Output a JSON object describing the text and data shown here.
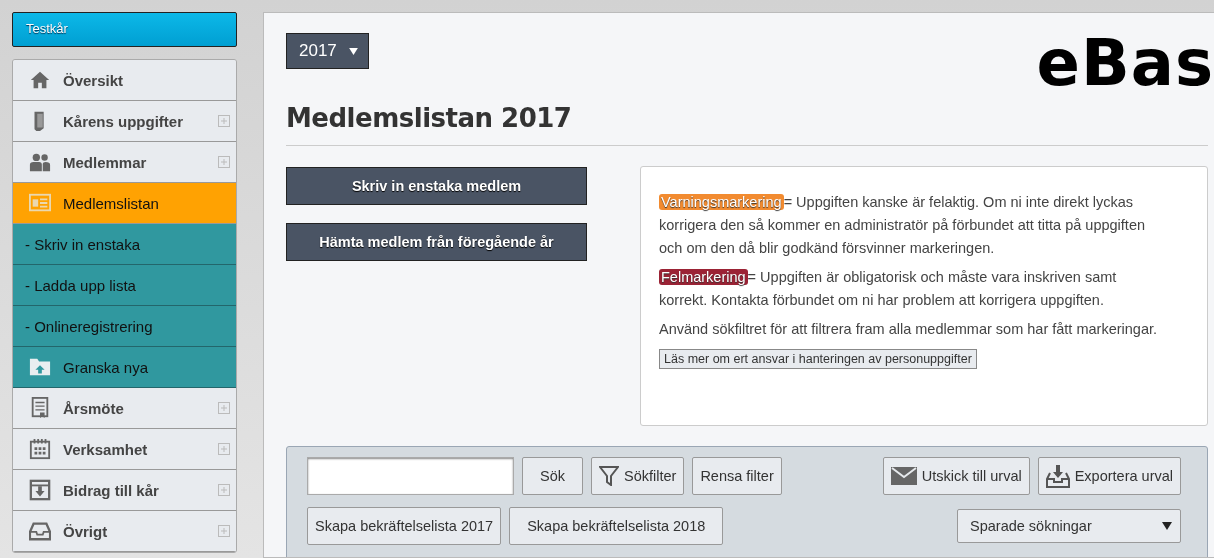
{
  "organization": {
    "name": "Testkår"
  },
  "sidebar": {
    "items": [
      {
        "label": "Översikt",
        "kind": "main",
        "selected": false,
        "expandable": false
      },
      {
        "label": "Kårens uppgifter",
        "kind": "main",
        "selected": false,
        "expandable": true
      },
      {
        "label": "Medlemmar",
        "kind": "main",
        "selected": false,
        "expandable": true
      },
      {
        "label": "Medlemslistan",
        "kind": "main",
        "selected": true,
        "expandable": false
      },
      {
        "label": "- Skriv in enstaka",
        "kind": "sub",
        "selected": false,
        "expandable": false
      },
      {
        "label": "- Ladda upp lista",
        "kind": "sub",
        "selected": false,
        "expandable": false
      },
      {
        "label": "- Onlineregistrering",
        "kind": "sub",
        "selected": false,
        "expandable": false
      },
      {
        "label": "Granska nya",
        "kind": "sub",
        "selected": false,
        "expandable": false
      },
      {
        "label": "Årsmöte",
        "kind": "main",
        "selected": false,
        "expandable": true
      },
      {
        "label": "Verksamhet",
        "kind": "main",
        "selected": false,
        "expandable": true
      },
      {
        "label": "Bidrag till kår",
        "kind": "main",
        "selected": false,
        "expandable": true
      },
      {
        "label": "Övrigt",
        "kind": "main",
        "selected": false,
        "expandable": true
      }
    ]
  },
  "year_select": {
    "value": "2017"
  },
  "logo": "eBas",
  "page_title": "Medlemslistan 2017",
  "actions": [
    "Skriv in enstaka medlem",
    "Hämta medlem från föregående år"
  ],
  "info": {
    "paragraphs": [
      {
        "tag": {
          "text": "Varningsmarkering",
          "color": "#f28b30"
        },
        "text": "= Uppgiften kanske är felaktig. Om ni inte direkt lyckas korrigera den så kommer en administratör på förbundet att titta på uppgiften och om den då blir godkänd försvinner markeringen."
      },
      {
        "tag": {
          "text": "Felmarkering",
          "color": "#9b2335"
        },
        "text": "= Uppgiften är obligatorisk och måste vara inskriven samt korrekt. Kontakta förbundet om ni har problem att korrigera uppgiften."
      },
      {
        "text": "Använd sökfiltret för att filtrera fram alla medlemmar som har fått markeringar."
      }
    ],
    "link_button": "Läs mer om ert ansvar i hanteringen av personuppgifter"
  },
  "toolbar": {
    "search_button": "Sök",
    "filter_button": "Sökfilter",
    "clear_button": "Rensa filter",
    "mail_button": "Utskick till urval",
    "export_button": "Exportera urval",
    "confirm_buttons": [
      "Skapa bekräftelselista 2017",
      "Skapa bekräftelselista 2018"
    ],
    "saved_searches": {
      "value": "Sparade sökningar"
    }
  }
}
